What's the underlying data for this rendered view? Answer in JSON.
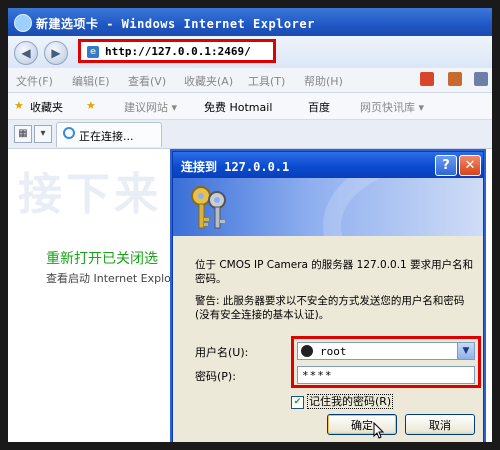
{
  "window": {
    "title": "新建选项卡 - Windows Internet Explorer"
  },
  "address": {
    "url": "http://127.0.0.1:2469/"
  },
  "menu": {
    "items": [
      "文件(F)",
      "编辑(E)",
      "查看(V)",
      "收藏夹(A)",
      "工具(T)",
      "帮助(H)"
    ]
  },
  "favorites": {
    "label": "收藏夹",
    "items": [
      "建议网站 ▾",
      "免费 Hotmail",
      "百度",
      "网页快讯库 ▾"
    ]
  },
  "tab": {
    "label": "正在连接..."
  },
  "page": {
    "watermark": "接下来",
    "reopen_link": "重新打开已关闭选",
    "resume_text": "查看启动 Internet Explor"
  },
  "dialog": {
    "title": "连接到 127.0.0.1",
    "message": "位于 CMOS IP Camera 的服务器 127.0.0.1 要求用户名和密码。",
    "warning": "警告: 此服务器要求以不安全的方式发送您的用户名和密码(没有安全连接的基本认证)。",
    "username_label": "用户名(U):",
    "password_label": "密码(P):",
    "username_value": "root",
    "password_value": "****",
    "remember_label": "记住我的密码(R)",
    "ok_label": "确定",
    "cancel_label": "取消"
  },
  "colors": {
    "highlight": "#e00000",
    "title_blue": "#0b4bd0",
    "reopen_green": "#19a319"
  },
  "icons": [
    "ie-icon",
    "back-icon",
    "forward-icon",
    "page-icon",
    "home-icon",
    "print-icon",
    "page-menu-icon",
    "star-icon",
    "keys-icon",
    "user-icon",
    "dropdown-icon",
    "mouse-cursor-icon"
  ]
}
